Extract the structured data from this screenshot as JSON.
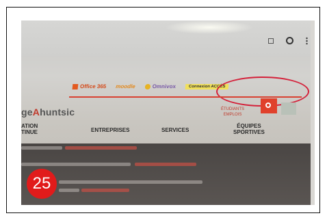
{
  "browser": {
    "icons": [
      "grid-icon",
      "user-icon",
      "menu-dots-icon"
    ]
  },
  "links": {
    "office": "Office 365",
    "moodle": "moodle",
    "onenote": "Omnivox",
    "connect": "Connexion ACCÈS"
  },
  "site": {
    "brand_prefix": "ge",
    "brand_highlight": "A",
    "brand_suffix": "huntsic",
    "red_link_line1": "ÉTUDIANTS",
    "red_link_line2": "EMPLOIS"
  },
  "nav": {
    "item1_line1": "ATION",
    "item1_line2": "TINUE",
    "item2": "ENTREPRISES",
    "item3": "SERVICES",
    "item4_line1": "ÉQUIPES",
    "item4_line2": "SPORTIVES"
  },
  "badge": {
    "number": "25"
  },
  "colors": {
    "annotation": "#d4213a",
    "badge": "#e11b1b",
    "brand_accent": "#c0392b"
  }
}
